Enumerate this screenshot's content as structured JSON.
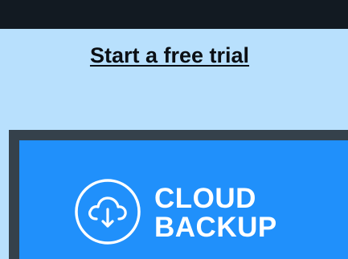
{
  "header": {
    "background": "#121a22"
  },
  "hero": {
    "background": "#b8e0fd",
    "trial_link_label": "Start a free trial"
  },
  "product_card": {
    "frame_color": "#35414b",
    "card_color": "#2090fb",
    "icon": "cloud-download-icon",
    "title_line1": "CLOUD",
    "title_line2": "BACKUP"
  }
}
